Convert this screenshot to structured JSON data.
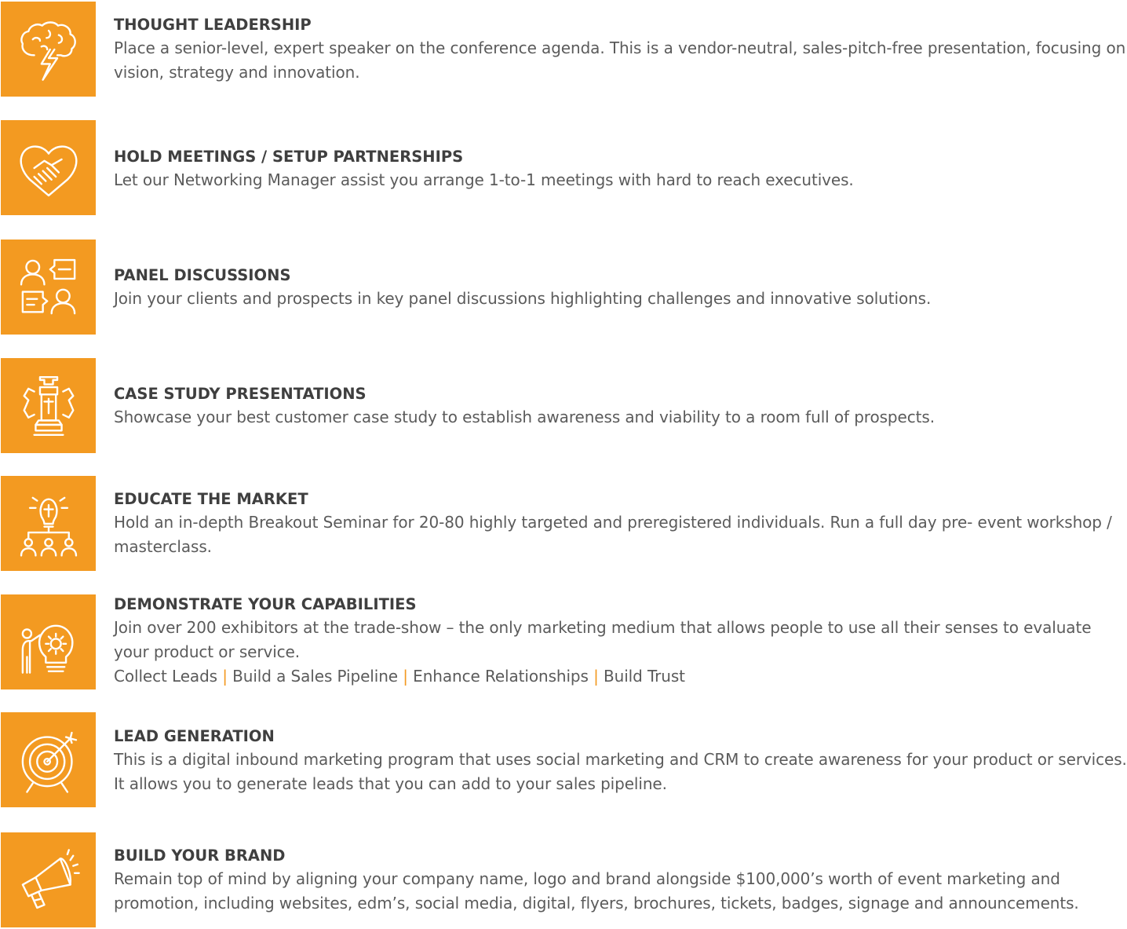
{
  "accent_color": "#f39a21",
  "items": [
    {
      "icon": "brain-lightning-icon",
      "title": "THOUGHT LEADERSHIP",
      "description": "Place a senior-level, expert speaker on the conference agenda. This is a vendor-neutral, sales-pitch-free presentation, focusing on vision, strategy and innovation."
    },
    {
      "icon": "handshake-heart-icon",
      "title": "HOLD MEETINGS / SETUP PARTNERSHIPS",
      "description": "Let our Networking Manager assist you arrange 1-to-1 meetings with hard to reach executives."
    },
    {
      "icon": "discussion-icon",
      "title": "PANEL DISCUSSIONS",
      "description": "Join your clients and prospects in key panel discussions highlighting challenges and innovative solutions."
    },
    {
      "icon": "chess-rook-gear-icon",
      "title": "CASE STUDY PRESENTATIONS",
      "description": "Showcase your best customer case study to establish awareness and viability to a room full of prospects."
    },
    {
      "icon": "lightbulb-audience-icon",
      "title": "EDUCATE THE MARKET",
      "description": "Hold an in-depth Breakout Seminar for 20-80 highly targeted and preregistered individuals. Run a full day pre- event workshop / masterclass."
    },
    {
      "icon": "presenter-gear-bulb-icon",
      "title": "DEMONSTRATE YOUR CAPABILITIES",
      "description": "Join over 200 exhibitors at the trade-show – the only marketing medium that allows people to use all their senses to evaluate your product or service.",
      "tags": [
        "Collect Leads",
        "Build a Sales Pipeline",
        "Enhance Relationships",
        "Build Trust"
      ],
      "tag_separator": "|"
    },
    {
      "icon": "target-arrow-icon",
      "title": "LEAD GENERATION",
      "description": "This is a digital inbound marketing program that uses social marketing and CRM to create awareness for your product or services. It allows you to generate leads that you can add to your sales pipeline."
    },
    {
      "icon": "megaphone-icon",
      "title": "BUILD YOUR BRAND",
      "description": "Remain top of mind by aligning your company name, logo and brand alongside $100,000’s worth of event marketing and promotion, including websites, edm’s, social media, digital, flyers, brochures, tickets, badges, signage and announcements."
    }
  ]
}
